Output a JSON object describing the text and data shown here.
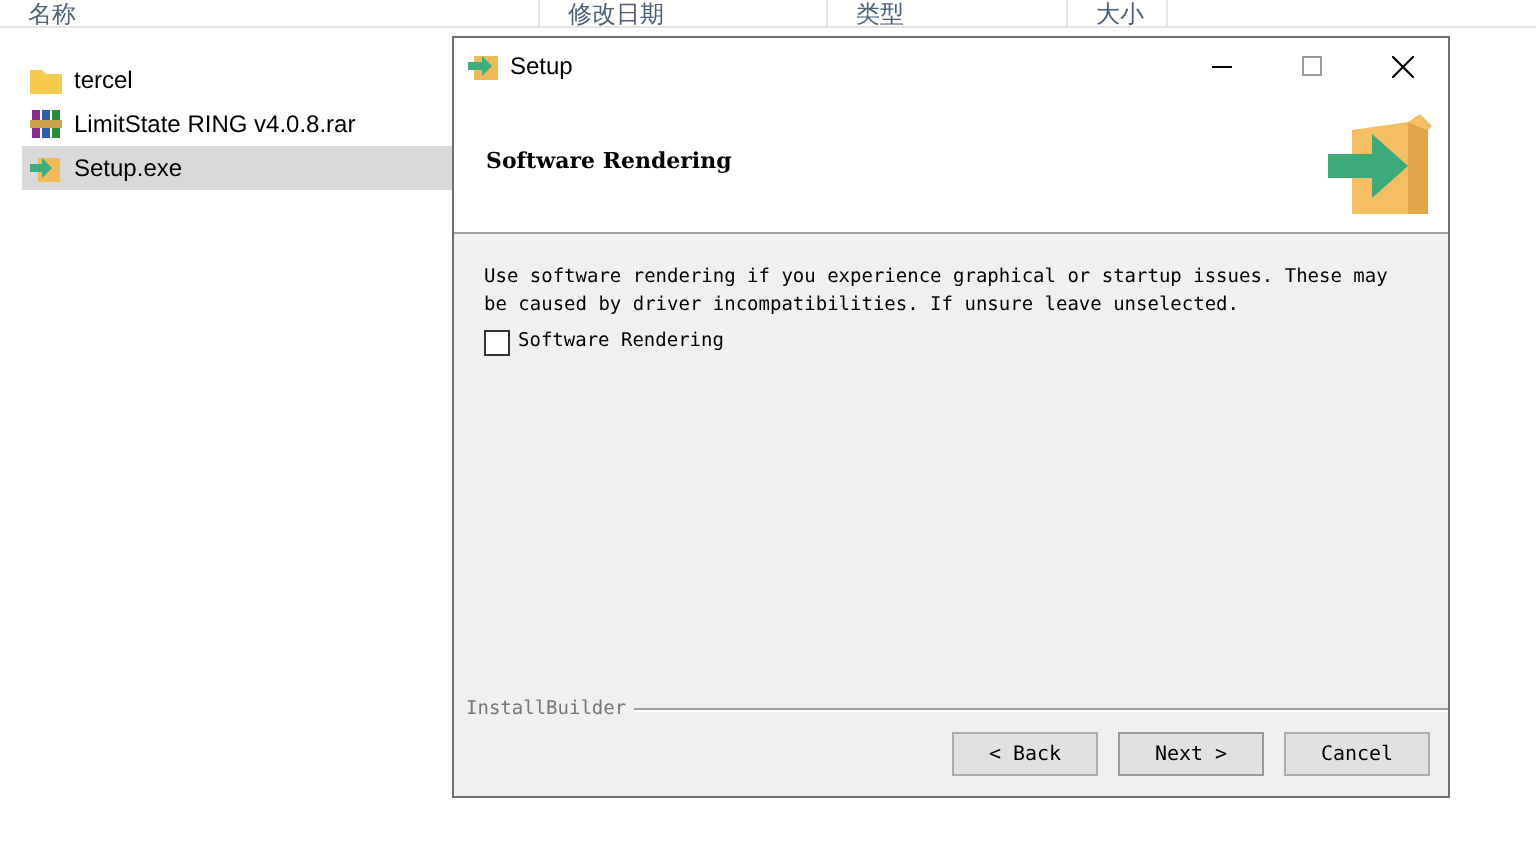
{
  "explorer": {
    "columns": [
      "名称",
      "修改日期",
      "类型",
      "大小"
    ],
    "files": [
      {
        "name": "tercel",
        "kind": "folder",
        "selected": false
      },
      {
        "name": "LimitState RING v4.0.8.rar",
        "kind": "archive",
        "selected": false
      },
      {
        "name": "Setup.exe",
        "kind": "installer",
        "selected": true
      }
    ]
  },
  "dialog": {
    "title": "Setup",
    "heading": "Software Rendering",
    "description": "Use software rendering if you experience graphical or startup issues. These may be caused by driver incompatibilities. If unsure leave unselected.",
    "checkbox": {
      "label": "Software Rendering",
      "checked": false
    },
    "footer_label": "InstallBuilder",
    "buttons": [
      {
        "label": "< Back",
        "kind": "secondary"
      },
      {
        "label": "Next >",
        "kind": "default"
      },
      {
        "label": "Cancel",
        "kind": "secondary"
      }
    ]
  }
}
